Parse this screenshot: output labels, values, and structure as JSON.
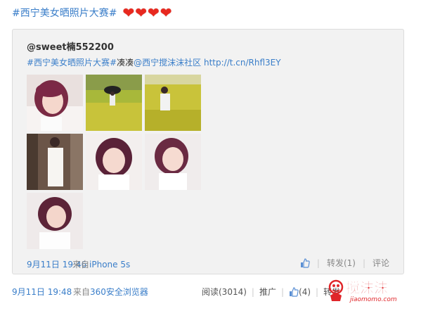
{
  "post": {
    "topic": "#西宁美女晒照片大赛#",
    "hearts": [
      "❤",
      "❤",
      "❤",
      "❤"
    ]
  },
  "retweet": {
    "author": "@sweet楠552200",
    "text_topic": "#西宁美女晒照片大赛#",
    "text_plain": "凑凑",
    "text_mention": "@西宁搅沫沫社区",
    "text_link": "http://t.cn/Rhfl3EY",
    "time": "9月11日 19:46",
    "source_prefix": "来自",
    "source": "iPhone 5s",
    "repost_label": "转发(1)",
    "comment_label": "评论",
    "photos": [
      {
        "name": "photo-1"
      },
      {
        "name": "photo-2"
      },
      {
        "name": "photo-3"
      },
      {
        "name": "photo-4"
      },
      {
        "name": "photo-5"
      },
      {
        "name": "photo-6"
      },
      {
        "name": "photo-7"
      }
    ]
  },
  "footer": {
    "time": "9月11日 19:48",
    "source_prefix": "来自",
    "source": "360安全浏览器",
    "read_label": "阅读(3014)",
    "promote_label": "推广",
    "like_label": "(4)",
    "repost_label": "转发"
  },
  "logo": {
    "text": "搅沫沫",
    "domain": "jiaomomo.com"
  },
  "colors": {
    "link": "#3a7ec9",
    "panel_bg": "#f2f2f2",
    "heart": "#e8281f",
    "logo_red": "#e0262a"
  }
}
